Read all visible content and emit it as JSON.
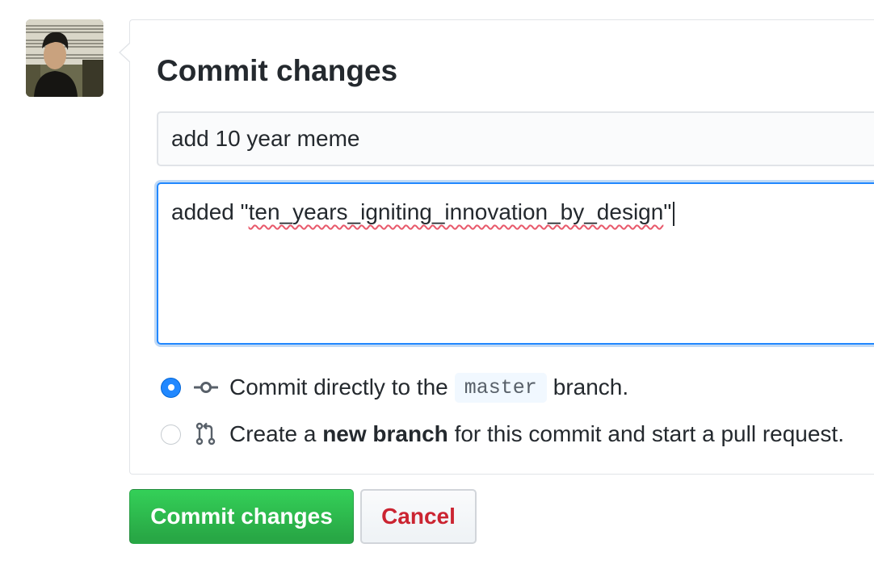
{
  "form": {
    "title": "Commit changes",
    "summary_value": "add 10 year meme",
    "description": {
      "prefix": "added \"",
      "misspelled": "ten_years_igniting_innovation_by_design",
      "suffix": "\""
    }
  },
  "options": {
    "direct": {
      "before": "Commit directly to the",
      "branch": "master",
      "after": "branch.",
      "checked": true,
      "icon": "git-commit-icon"
    },
    "new_branch": {
      "before": "Create a",
      "bold": "new branch",
      "after": "for this commit and start a pull request.",
      "checked": false,
      "icon": "git-pull-request-icon"
    }
  },
  "buttons": {
    "commit": "Commit changes",
    "cancel": "Cancel"
  },
  "colors": {
    "primary_green": "#28a745",
    "cancel_red": "#cb2431",
    "focus_blue": "#2188ff"
  }
}
